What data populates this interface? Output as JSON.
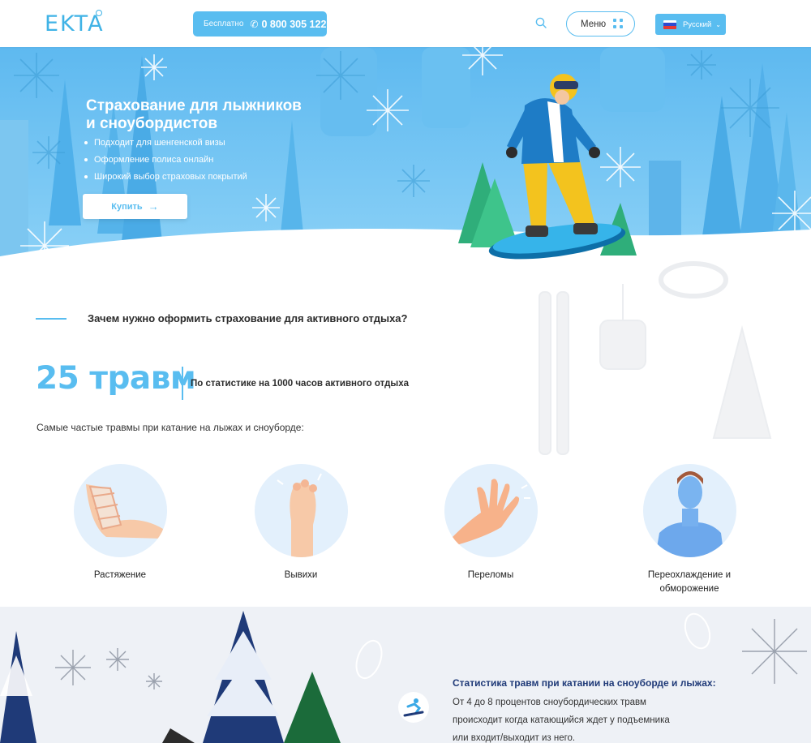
{
  "header": {
    "logo": "EKTA",
    "phone_free": "Бесплатно",
    "phone_number": "0 800 305 122",
    "menu_label": "Меню",
    "language": "Русский"
  },
  "hero": {
    "title_line1": "Страхование для лыжников",
    "title_line2": "и сноубордистов",
    "bullets": [
      "Подходит для шенгенской визы",
      "Оформление полиса онлайн",
      "Широкий выбор страховых покрытий"
    ],
    "buy_label": "Купить"
  },
  "why": {
    "title": "Зачем нужно оформить страхование для активного отдыха?",
    "stat_big": "25 травм",
    "stat_sub": "По  статистике на 1000 часов активного отдыха",
    "intro": "Самые частые травмы при катание на лыжах и сноуборде:"
  },
  "injuries": [
    {
      "label_1": "Растяжение",
      "label_2": ""
    },
    {
      "label_1": "Вывихи",
      "label_2": ""
    },
    {
      "label_1": "Переломы",
      "label_2": ""
    },
    {
      "label_1": "Переохлаждение и",
      "label_2": "обморожение"
    }
  ],
  "stats_block": {
    "title": "Статистика травм при катании на сноуборде и лыжах:",
    "line1": "От 4 до 8 процентов сноубордических травм",
    "line2": "происходит когда катающийся ждет у подъемника",
    "line3": "или входит/выходит из него."
  },
  "colors": {
    "accent": "#59bdf0",
    "logo": "#40b3e6",
    "hero_bg": "#6fc3f2",
    "navy": "#1f3a78"
  }
}
